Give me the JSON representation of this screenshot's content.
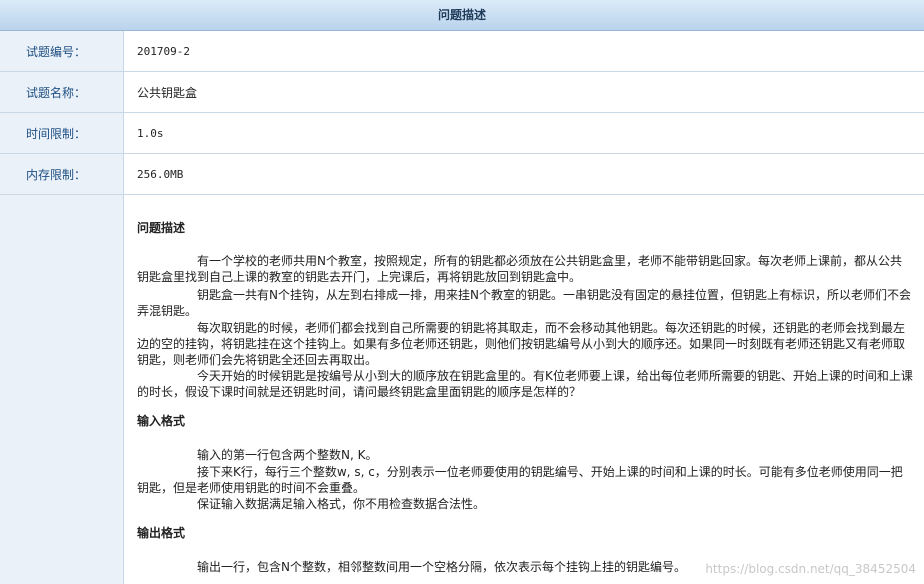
{
  "header": {
    "title": "问题描述"
  },
  "fields": [
    {
      "label": "试题编号：",
      "value": "201709-2"
    },
    {
      "label": "试题名称：",
      "value": "公共钥匙盒"
    },
    {
      "label": "时间限制：",
      "value": "1.0s"
    },
    {
      "label": "内存限制：",
      "value": "256.0MB"
    }
  ],
  "description": {
    "problem_title": "问题描述",
    "problem_paras": [
      "有一个学校的老师共用N个教室，按照规定，所有的钥匙都必须放在公共钥匙盒里，老师不能带钥匙回家。每次老师上课前，都从公共钥匙盒里找到自己上课的教室的钥匙去开门，上完课后，再将钥匙放回到钥匙盒中。",
      "钥匙盒一共有N个挂钩，从左到右排成一排，用来挂N个教室的钥匙。一串钥匙没有固定的悬挂位置，但钥匙上有标识，所以老师们不会弄混钥匙。",
      "每次取钥匙的时候，老师们都会找到自己所需要的钥匙将其取走，而不会移动其他钥匙。每次还钥匙的时候，还钥匙的老师会找到最左边的空的挂钩，将钥匙挂在这个挂钩上。如果有多位老师还钥匙，则他们按钥匙编号从小到大的顺序还。如果同一时刻既有老师还钥匙又有老师取钥匙，则老师们会先将钥匙全还回去再取出。",
      "今天开始的时候钥匙是按编号从小到大的顺序放在钥匙盒里的。有K位老师要上课，给出每位老师所需要的钥匙、开始上课的时间和上课的时长，假设下课时间就是还钥匙时间，请问最终钥匙盒里面钥匙的顺序是怎样的？"
    ],
    "input_title": "输入格式",
    "input_paras": [
      "输入的第一行包含两个整数N, K。",
      "接下来K行，每行三个整数w, s, c，分别表示一位老师要使用的钥匙编号、开始上课的时间和上课的时长。可能有多位老师使用同一把钥匙，但是老师使用钥匙的时间不会重叠。",
      "保证输入数据满足输入格式，你不用检查数据合法性。"
    ],
    "output_title": "输出格式",
    "output_paras": [
      "输出一行，包含N个整数，相邻整数间用一个空格分隔，依次表示每个挂钩上挂的钥匙编号。"
    ]
  },
  "watermark": "https://blog.csdn.net/qq_38452504"
}
